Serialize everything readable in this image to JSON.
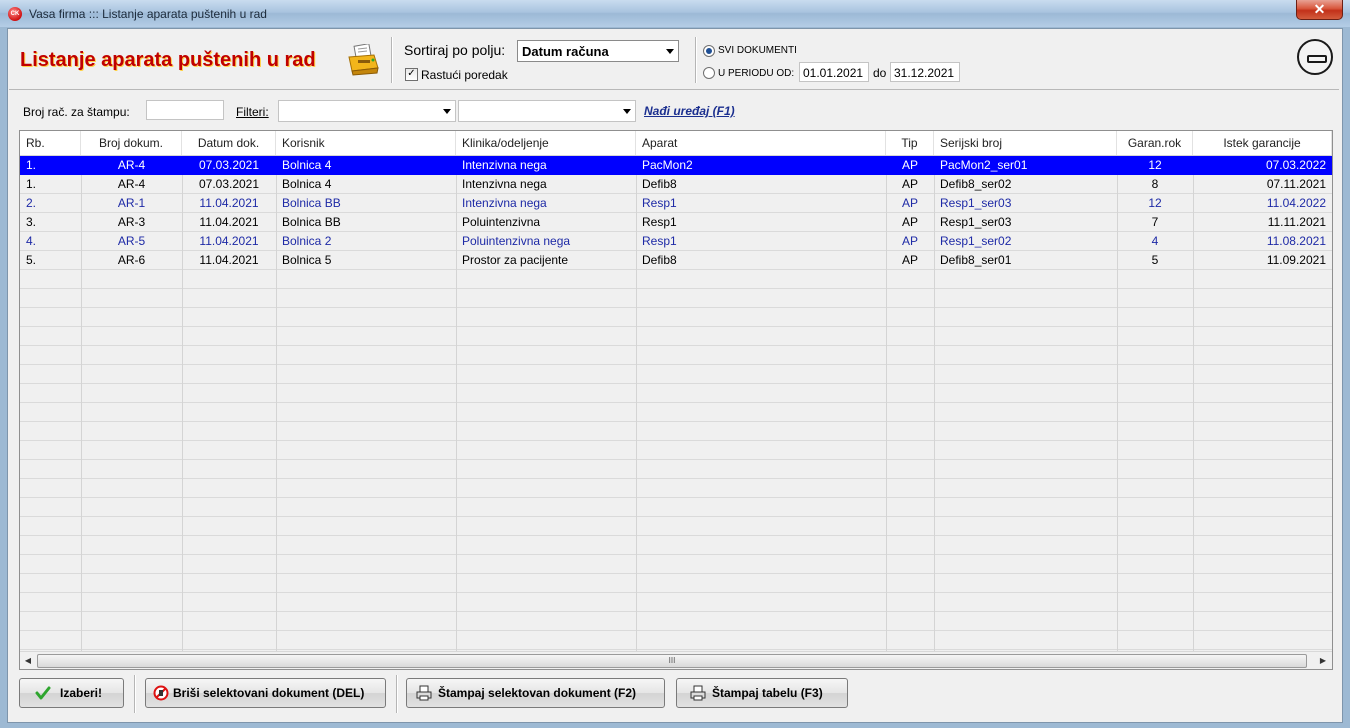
{
  "window": {
    "icon_text": "CK",
    "title": "Vasa firma ::: Listanje aparata puštenih u rad",
    "close": "✕"
  },
  "header": {
    "page_title": "Listanje aparata puštenih u rad",
    "sort_label": "Sortiraj po polju:",
    "sort_value": "Datum računa",
    "ascending_label": "Rastući poredak",
    "ascending_checked": true,
    "radio_all": "SVI DOKUMENTI",
    "radio_period": "U PERIODU OD:",
    "date_from": "01.01.2021",
    "do_label": "do",
    "date_to": "31.12.2021",
    "selected_radio": "all"
  },
  "filters": {
    "print_number_label": "Broj rač. za štampu:",
    "print_number_value": "",
    "filters_label": "Filteri:",
    "filter1_value": "",
    "filter2_value": "",
    "find_device": "Nađi uređaj (F1)"
  },
  "table": {
    "columns": [
      "Rb.",
      "Broj dokum.",
      "Datum dok.",
      "Korisnik",
      "Klinika/odeljenje",
      "Aparat",
      "Tip",
      "Serijski broj",
      "Garan.rok",
      "Istek garancije"
    ],
    "rows": [
      {
        "rb": "1.",
        "broj": "AR-4",
        "datum": "07.03.2021",
        "korisnik": "Bolnica 4",
        "klinika": "Intenzivna nega",
        "aparat": "PacMon2",
        "tip": "AP",
        "serijski": "PacMon2_ser01",
        "rok": "12",
        "istek": "07.03.2022"
      },
      {
        "rb": "1.",
        "broj": "AR-4",
        "datum": "07.03.2021",
        "korisnik": "Bolnica 4",
        "klinika": "Intenzivna nega",
        "aparat": "Defib8",
        "tip": "AP",
        "serijski": "Defib8_ser02",
        "rok": "8",
        "istek": "07.11.2021"
      },
      {
        "rb": "2.",
        "broj": "AR-1",
        "datum": "11.04.2021",
        "korisnik": "Bolnica BB",
        "klinika": "Intenzivna nega",
        "aparat": "Resp1",
        "tip": "AP",
        "serijski": "Resp1_ser03",
        "rok": "12",
        "istek": "11.04.2022"
      },
      {
        "rb": "3.",
        "broj": "AR-3",
        "datum": "11.04.2021",
        "korisnik": "Bolnica BB",
        "klinika": "Poluintenzivna",
        "aparat": "Resp1",
        "tip": "AP",
        "serijski": "Resp1_ser03",
        "rok": "7",
        "istek": "11.11.2021"
      },
      {
        "rb": "4.",
        "broj": "AR-5",
        "datum": "11.04.2021",
        "korisnik": "Bolnica 2",
        "klinika": "Poluintenzivna nega",
        "aparat": "Resp1",
        "tip": "AP",
        "serijski": "Resp1_ser02",
        "rok": "4",
        "istek": "11.08.2021"
      },
      {
        "rb": "5.",
        "broj": "AR-6",
        "datum": "11.04.2021",
        "korisnik": "Bolnica 5",
        "klinika": "Prostor za pacijente",
        "aparat": "Defib8",
        "tip": "AP",
        "serijski": "Defib8_ser01",
        "rok": "5",
        "istek": "11.09.2021"
      }
    ],
    "selected_row": 0,
    "scroll_grip": "III"
  },
  "buttons": {
    "select": "Izaberi!",
    "delete": "Briši selektovani dokument (DEL)",
    "print_doc": "Štampaj selektovan dokument (F2)",
    "print_table": "Štampaj tabelu (F3)"
  }
}
